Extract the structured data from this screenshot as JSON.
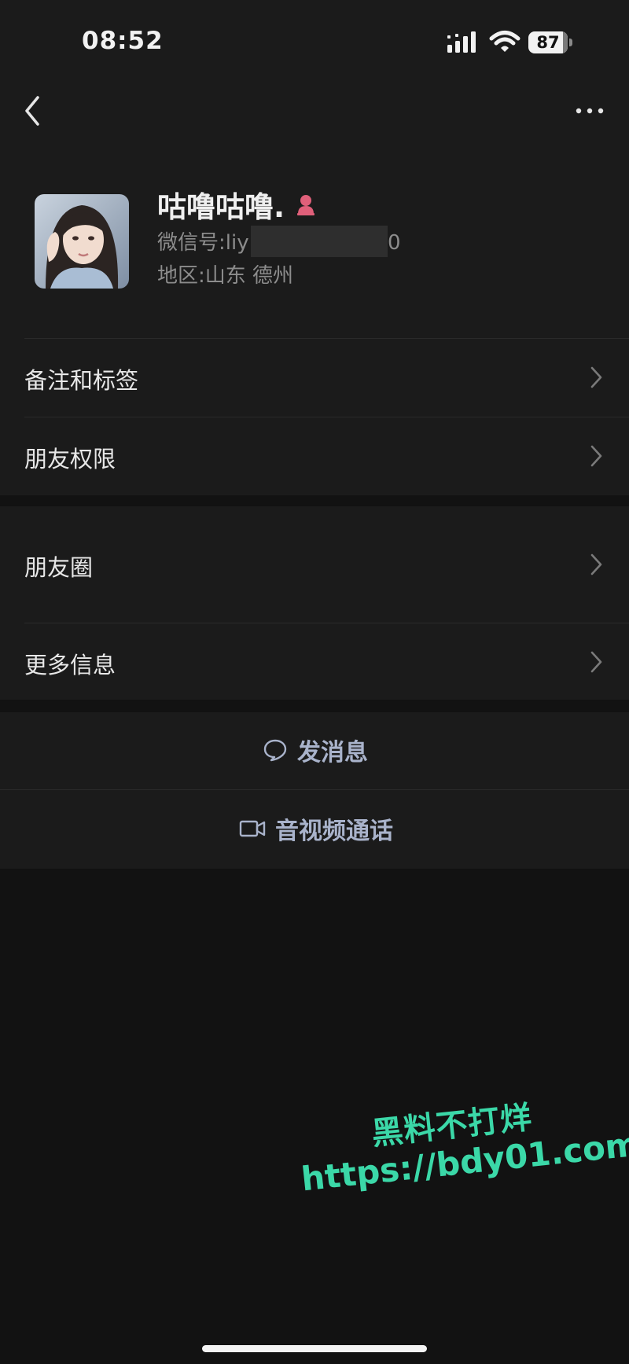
{
  "status_bar": {
    "time": "08:52",
    "battery_level": "87",
    "signal_icon": "cellular-signal-icon",
    "wifi_icon": "wifi-icon"
  },
  "nav": {
    "back_icon": "chevron-left-icon",
    "more_icon": "more-horizontal-icon"
  },
  "profile": {
    "name": "咕噜咕噜.",
    "gender_icon": "female-icon",
    "wechat_id_label": "微信号:",
    "wechat_id_prefix": "liy",
    "wechat_id_suffix": "0",
    "region": "地区:山东 德州"
  },
  "list_section_1": [
    {
      "label": "备注和标签"
    },
    {
      "label": "朋友权限"
    }
  ],
  "list_section_2": [
    {
      "label": "朋友圈"
    },
    {
      "label": "更多信息"
    }
  ],
  "actions": {
    "message_label": "发消息",
    "message_icon": "chat-bubble-icon",
    "call_label": "音视频通话",
    "call_icon": "video-camera-icon"
  },
  "watermark": {
    "line1": "黑料不打烊",
    "line2": "https://bdy01.com"
  },
  "colors": {
    "background": "#121212",
    "panel": "#1b1b1b",
    "action_text": "#a9b3cb",
    "watermark": "#3bd8a8",
    "gender_female": "#e0607a"
  }
}
